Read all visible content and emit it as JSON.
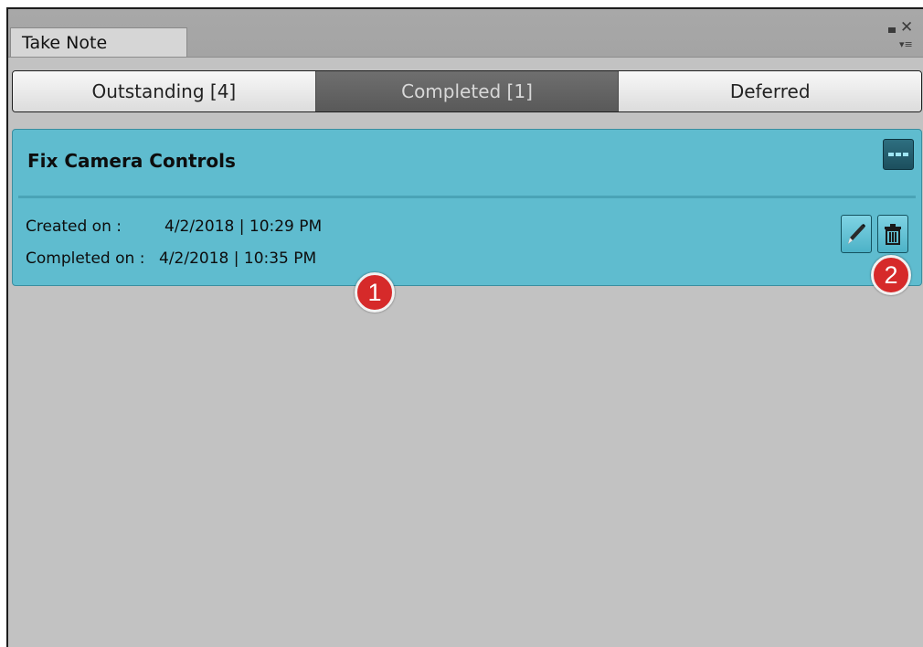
{
  "window": {
    "tab_label": "Take Note"
  },
  "tabs": [
    {
      "label": "Outstanding [4]",
      "active": false
    },
    {
      "label": "Completed [1]",
      "active": true
    },
    {
      "label": "Deferred",
      "active": false
    }
  ],
  "note": {
    "title": "Fix Camera Controls",
    "created_label": "Created on :",
    "created_value": "4/2/2018 | 10:29 PM",
    "completed_label": "Completed on :",
    "completed_value": "4/2/2018 | 10:35 PM"
  },
  "icons": {
    "more": "more-options-icon",
    "edit": "pencil-icon",
    "delete": "trash-icon",
    "maximize": "maximize-icon",
    "close": "close-icon",
    "menu": "panel-menu-icon"
  },
  "callouts": {
    "first": "1",
    "second": "2"
  },
  "colors": {
    "card": "#5fbccf",
    "active_tab": "#595959",
    "callout": "#d62a2a"
  }
}
